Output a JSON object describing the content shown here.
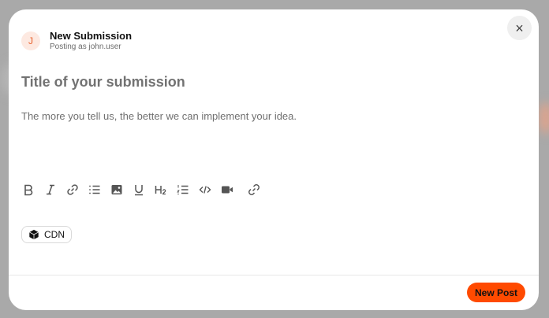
{
  "colors": {
    "accent": "#ff4a00",
    "avatar_bg": "#fde9e1",
    "avatar_fg": "#e8612c",
    "backdrop": "#a9a9a9"
  },
  "header": {
    "avatar_initial": "J",
    "title": "New Submission",
    "subtitle": "Posting as john.user"
  },
  "close_icon": "×",
  "form": {
    "title_placeholder": "Title of your submission",
    "body_placeholder": "The more you tell us, the better we can implement your idea."
  },
  "toolbar": {
    "items": [
      "bold-icon",
      "italic-icon",
      "link-icon",
      "bullet-list-icon",
      "image-icon",
      "underline-icon",
      "heading-icon",
      "ordered-list-icon",
      "code-icon",
      "video-icon",
      "url-link-icon"
    ]
  },
  "tag": {
    "icon": "cube-icon",
    "label": "CDN"
  },
  "footer": {
    "post_label": "New Post"
  }
}
